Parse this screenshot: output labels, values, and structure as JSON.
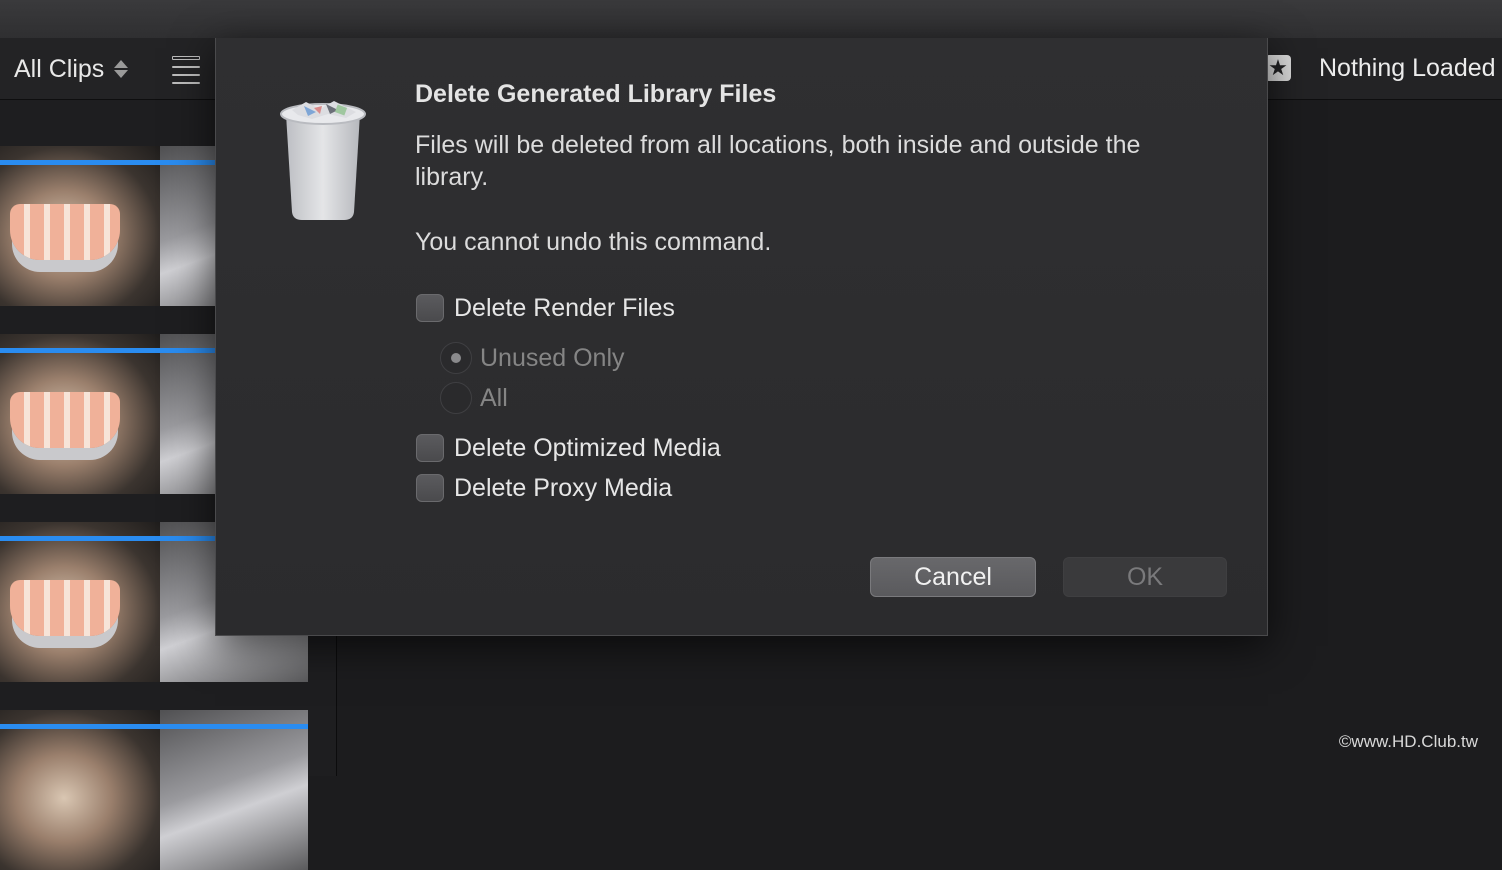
{
  "toolbar": {
    "clips_filter": "All Clips",
    "viewer_title": "Nothing Loaded"
  },
  "icons": {
    "filter_arrows": "updown-chevron-icon",
    "list_view": "list-view-icon",
    "favorite": "star-icon",
    "dialog": "trash-icon"
  },
  "dialog": {
    "title": "Delete Generated Library Files",
    "message_1": "Files will be deleted from all locations, both inside and outside the library.",
    "message_2": "You cannot undo this command.",
    "options": {
      "render_files": {
        "label": "Delete Render Files",
        "checked": false
      },
      "unused_only": {
        "label": "Unused Only",
        "selected": true,
        "enabled": false
      },
      "all": {
        "label": "All",
        "selected": false,
        "enabled": false
      },
      "optimized_media": {
        "label": "Delete Optimized Media",
        "checked": false
      },
      "proxy_media": {
        "label": "Delete Proxy Media",
        "checked": false
      }
    },
    "buttons": {
      "cancel": "Cancel",
      "ok": "OK"
    }
  },
  "watermark": "©www.HD.Club.tw",
  "colors": {
    "accent_blue": "#2a8cf0",
    "dialog_bg": "#2d2d2f",
    "app_bg": "#1c1c1e"
  }
}
